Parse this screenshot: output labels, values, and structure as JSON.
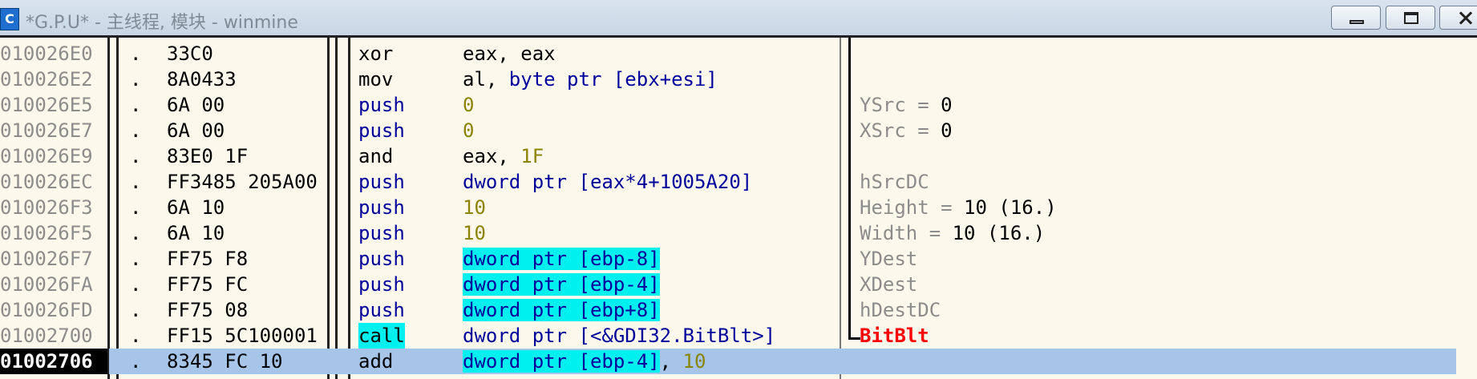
{
  "window": {
    "icon_letter": "C",
    "title": "*G.P.U* -  主线程, 模块 - winmine",
    "buttons": {
      "minimize": "minimize",
      "maximize": "maximize",
      "close": "close"
    }
  },
  "rows": [
    {
      "addr": "010026E0",
      "dot": ".",
      "hex": "33C0",
      "mnemonic": "xor",
      "mnem_color": "black",
      "operand": [
        {
          "t": "eax, eax",
          "c": "std"
        }
      ],
      "comment": []
    },
    {
      "addr": "010026E2",
      "dot": ".",
      "hex": "8A0433",
      "mnemonic": "mov",
      "mnem_color": "black",
      "operand": [
        {
          "t": "al, ",
          "c": "std"
        },
        {
          "t": "byte ptr [ebx+esi]",
          "c": "blue"
        }
      ],
      "comment": []
    },
    {
      "addr": "010026E5",
      "dot": ".",
      "hex": "6A 00",
      "mnemonic": "push",
      "mnem_color": "blue",
      "operand": [
        {
          "t": "0",
          "c": "num"
        }
      ],
      "comment": [
        {
          "t": "YSrc = ",
          "c": "gray"
        },
        {
          "t": "0",
          "c": "std"
        }
      ]
    },
    {
      "addr": "010026E7",
      "dot": ".",
      "hex": "6A 00",
      "mnemonic": "push",
      "mnem_color": "blue",
      "operand": [
        {
          "t": "0",
          "c": "num"
        }
      ],
      "comment": [
        {
          "t": "XSrc = ",
          "c": "gray"
        },
        {
          "t": "0",
          "c": "std"
        }
      ]
    },
    {
      "addr": "010026E9",
      "dot": ".",
      "hex": "83E0 1F",
      "mnemonic": "and",
      "mnem_color": "black",
      "operand": [
        {
          "t": "eax, ",
          "c": "std"
        },
        {
          "t": "1F",
          "c": "num"
        }
      ],
      "comment": []
    },
    {
      "addr": "010026EC",
      "dot": ".",
      "hex": "FF3485 205A00",
      "mnemonic": "push",
      "mnem_color": "blue",
      "operand": [
        {
          "t": "dword ptr [eax*4+1005A20]",
          "c": "blue"
        }
      ],
      "comment": [
        {
          "t": "hSrcDC",
          "c": "gray"
        }
      ]
    },
    {
      "addr": "010026F3",
      "dot": ".",
      "hex": "6A 10",
      "mnemonic": "push",
      "mnem_color": "blue",
      "operand": [
        {
          "t": "10",
          "c": "num"
        }
      ],
      "comment": [
        {
          "t": "Height = ",
          "c": "gray"
        },
        {
          "t": "10 (16.)",
          "c": "std"
        }
      ]
    },
    {
      "addr": "010026F5",
      "dot": ".",
      "hex": "6A 10",
      "mnemonic": "push",
      "mnem_color": "blue",
      "operand": [
        {
          "t": "10",
          "c": "num"
        }
      ],
      "comment": [
        {
          "t": "Width = ",
          "c": "gray"
        },
        {
          "t": "10 (16.)",
          "c": "std"
        }
      ]
    },
    {
      "addr": "010026F7",
      "dot": ".",
      "hex": "FF75 F8",
      "mnemonic": "push",
      "mnem_color": "blue",
      "operand": [
        {
          "t": "dword ptr [ebp-8]",
          "c": "blue",
          "hl": true
        }
      ],
      "comment": [
        {
          "t": "YDest",
          "c": "gray"
        }
      ]
    },
    {
      "addr": "010026FA",
      "dot": ".",
      "hex": "FF75 FC",
      "mnemonic": "push",
      "mnem_color": "blue",
      "operand": [
        {
          "t": "dword ptr [ebp-4]",
          "c": "blue",
          "hl": true
        }
      ],
      "comment": [
        {
          "t": "XDest",
          "c": "gray"
        }
      ]
    },
    {
      "addr": "010026FD",
      "dot": ".",
      "hex": "FF75 08",
      "mnemonic": "push",
      "mnem_color": "blue",
      "operand": [
        {
          "t": "dword ptr [ebp+8]",
          "c": "blue",
          "hl": true
        }
      ],
      "comment": [
        {
          "t": "hDestDC",
          "c": "gray"
        }
      ]
    },
    {
      "addr": "01002700",
      "dot": ".",
      "hex": "FF15 5C100001",
      "mnemonic": "call",
      "mnem_color": "black",
      "mnem_hl": true,
      "operand": [
        {
          "t": "dword ptr [<&GDI32.BitBlt>]",
          "c": "blue"
        }
      ],
      "comment": [
        {
          "t": "BitBlt",
          "c": "red"
        }
      ],
      "bracket_end": true
    },
    {
      "addr": "01002706",
      "dot": ".",
      "hex": "8345 FC 10",
      "mnemonic": "add",
      "mnem_color": "black",
      "selected": true,
      "operand": [
        {
          "t": "dword ptr [ebp-4]",
          "c": "blue",
          "hl": true
        },
        {
          "t": ", ",
          "c": "std"
        },
        {
          "t": "10",
          "c": "num"
        }
      ],
      "comment": []
    }
  ],
  "colors": {
    "background": "#fdf8ec",
    "selection": "#a6c5e9",
    "highlight": "#00f0f0",
    "api_name": "#ff0000"
  }
}
